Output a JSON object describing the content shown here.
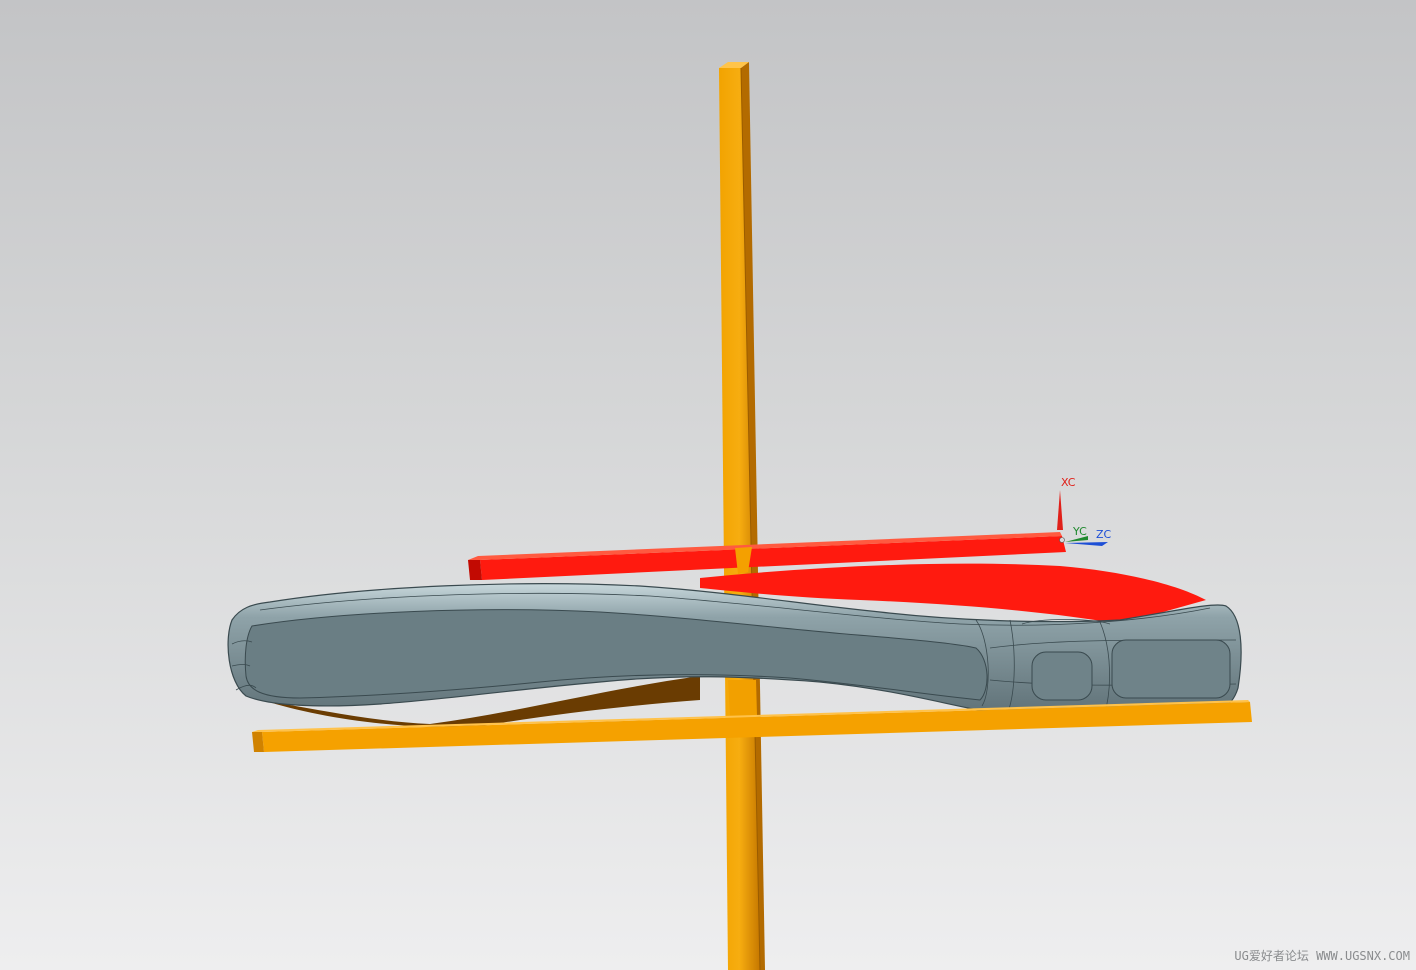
{
  "viewport": {
    "background_top": "#c3c4c6",
    "background_bottom": "#eeeeef"
  },
  "colors": {
    "datum_orange": "#f5a100",
    "datum_orange_dark": "#c97a00",
    "body_grey": "#6f8288",
    "body_grey_light": "#a9bec4",
    "face_red": "#ff1a0f",
    "underside_brown": "#6b3a00"
  },
  "csys": {
    "x_label": "XC",
    "y_label": "YC",
    "z_label": "ZC",
    "x_color": "#e0201a",
    "y_color": "#1f8a2e",
    "z_color": "#1d4fd6"
  },
  "watermark": {
    "text": "UG爱好者论坛 WWW.UGSNX.COM"
  }
}
